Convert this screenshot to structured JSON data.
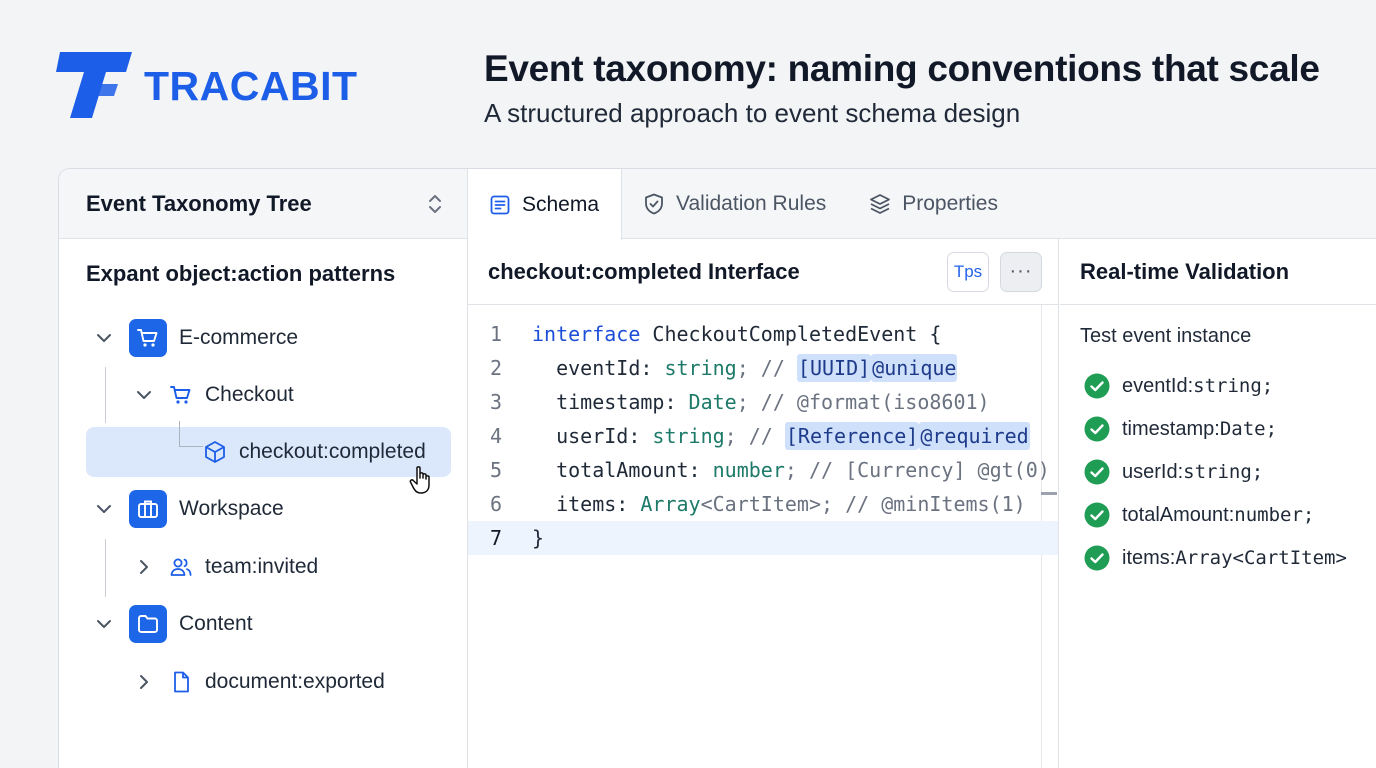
{
  "brand": {
    "name": "TRACABIT",
    "color": "#1d5ee8"
  },
  "header": {
    "title": "Event taxonomy: naming conventions that scale",
    "subtitle": "A structured approach to event schema design"
  },
  "sidebar": {
    "title": "Event Taxonomy Tree",
    "section_title": "Expant object:action patterns",
    "items": [
      {
        "label": "E-commerce",
        "icon": "cart-icon"
      },
      {
        "label": "Checkout",
        "icon": "cart-icon"
      },
      {
        "label": "checkout:completed",
        "icon": "cube-icon"
      },
      {
        "label": "Workspace",
        "icon": "briefcase-icon"
      },
      {
        "label": "team:invited",
        "icon": "users-icon"
      },
      {
        "label": "Content",
        "icon": "folder-icon"
      },
      {
        "label": "document:exported",
        "icon": "file-icon"
      }
    ]
  },
  "tabs": [
    {
      "label": "Schema",
      "icon": "schema-icon"
    },
    {
      "label": "Validation Rules",
      "icon": "shield-icon"
    },
    {
      "label": "Properties",
      "icon": "layers-icon"
    }
  ],
  "editor": {
    "title": "checkout:completed Interface",
    "ts_button": "Tps",
    "more_button": "···",
    "code": {
      "l1_kw": "interface",
      "l1_rest": " CheckoutCompletedEvent {",
      "l2_a": "  eventId: ",
      "l2_type": "string",
      "l2_b": "; // ",
      "l2_h1": "[UUID]",
      "l2_h2": "@unique",
      "l3_a": "  timestamp: ",
      "l3_type": "Date",
      "l3_b": "; // @format(iso8601)",
      "l4_a": "  userId: ",
      "l4_type": "string",
      "l4_b": "; // ",
      "l4_h1": "[Reference]",
      "l4_h2": "@required",
      "l5_a": "  totalAmount: ",
      "l5_type": "number",
      "l5_b": "; // [Currency] @gt(0)",
      "l6_a": "  items: ",
      "l6_type": "Array",
      "l6_b": "<CartItem>; // @minItems(1)",
      "l7": "}"
    }
  },
  "validation": {
    "title": "Real-time Validation",
    "subtitle": "Test event instance",
    "items": [
      {
        "name": "eventId:",
        "type": " string;"
      },
      {
        "name": "timestamp:",
        "type": " Date;"
      },
      {
        "name": "userId:",
        "type": " string;"
      },
      {
        "name": "totalAmount:",
        "type": " number;"
      },
      {
        "name": "items:",
        "type": " Array<CartItem>"
      }
    ],
    "status_color": "#1f9d55"
  }
}
